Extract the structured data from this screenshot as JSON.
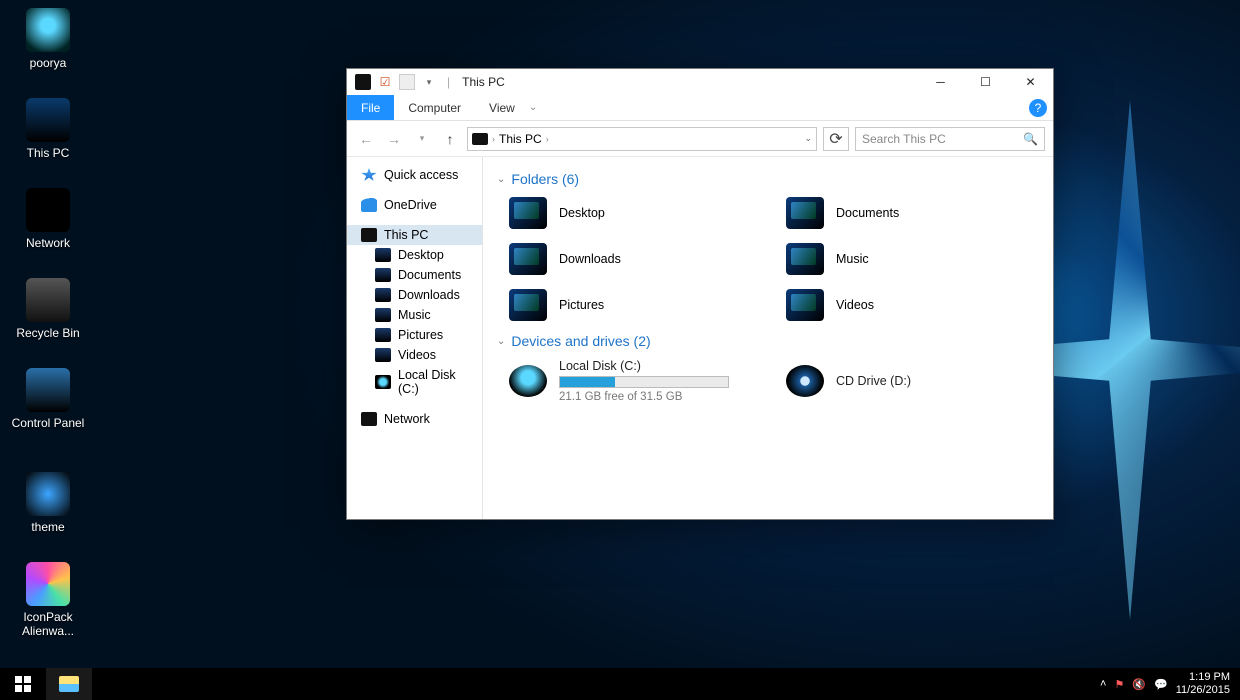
{
  "desktop_icons": [
    {
      "key": "poorya",
      "label": "poorya"
    },
    {
      "key": "thispc",
      "label": "This PC"
    },
    {
      "key": "network",
      "label": "Network"
    },
    {
      "key": "recycle",
      "label": "Recycle Bin"
    },
    {
      "key": "cpanel",
      "label": "Control Panel"
    },
    {
      "key": "theme",
      "label": "theme"
    },
    {
      "key": "iconpack",
      "label": "IconPack Alienwa..."
    }
  ],
  "taskbar": {
    "time": "1:19 PM",
    "date": "11/26/2015"
  },
  "window": {
    "title": "This PC",
    "ribbon": {
      "file": "File",
      "computer": "Computer",
      "view": "View"
    },
    "breadcrumb": {
      "root": "This PC"
    },
    "search_placeholder": "Search This PC",
    "sidebar": {
      "quick": "Quick access",
      "onedrive": "OneDrive",
      "thispc": "This PC",
      "children": [
        "Desktop",
        "Documents",
        "Downloads",
        "Music",
        "Pictures",
        "Videos",
        "Local Disk (C:)"
      ],
      "network": "Network"
    },
    "sections": {
      "folders_title": "Folders (6)",
      "folders": [
        "Desktop",
        "Documents",
        "Downloads",
        "Music",
        "Pictures",
        "Videos"
      ],
      "drives_title": "Devices and drives (2)",
      "drive_c": {
        "name": "Local Disk (C:)",
        "free": "21.1 GB free of 31.5 GB",
        "fill_percent": 33
      },
      "drive_d": {
        "name": "CD Drive (D:)"
      }
    }
  }
}
